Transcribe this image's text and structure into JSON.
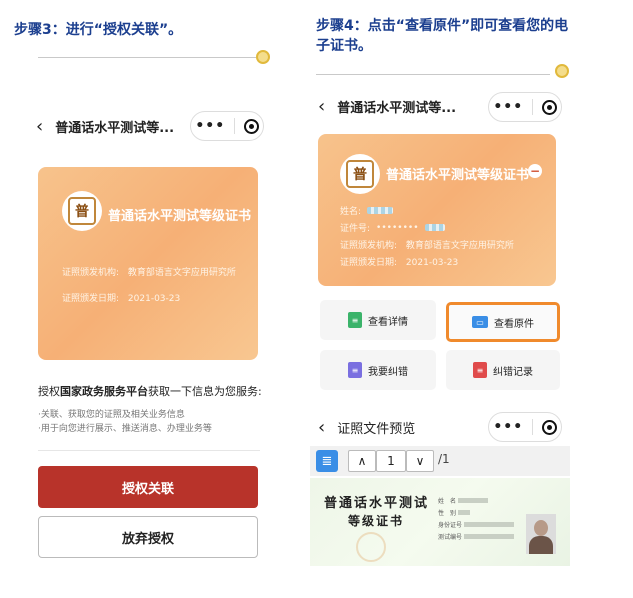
{
  "left": {
    "step_title": "步骤3：进行“授权关联”。",
    "nav_title": "普通话水平测试等...",
    "card": {
      "title": "普通话水平测试等级证书",
      "seal_char": "普",
      "issuer_label": "证照颁发机构:",
      "issuer_value": "教育部语言文字应用研究所",
      "date_label": "证照颁发日期:",
      "date_value": "2021-03-23"
    },
    "auth_text_pre": "授权",
    "auth_text_bold": "国家政务服务平台",
    "auth_text_post": "获取一下信息为您服务:",
    "bullets": [
      "·关联、获取您的证照及相关业务信息",
      "·用于向您进行展示、推送消息、办理业务等"
    ],
    "authorize_button": "授权关联",
    "decline_button": "放弃授权"
  },
  "right": {
    "step_title_line1": "步骤4：点击“查看原件”即可查看您的电",
    "step_title_line2": "子证书。",
    "nav_title": "普通话水平测试等...",
    "card": {
      "title": "普通话水平测试等级证书",
      "seal_char": "普",
      "name_label": "姓名:",
      "id_label": "证件号:",
      "id_value": "••••••••",
      "issuer_label": "证照颁发机构:",
      "issuer_value": "教育部语言文字应用研究所",
      "date_label": "证照颁发日期:",
      "date_value": "2021-03-23"
    },
    "actions": [
      {
        "label": "查看详情",
        "icon": "document-green-icon"
      },
      {
        "label": "查看原件",
        "icon": "id-card-blue-icon"
      },
      {
        "label": "我要纠错",
        "icon": "document-purple-icon"
      },
      {
        "label": "纠错记录",
        "icon": "document-red-icon"
      }
    ],
    "preview_title": "证照文件预览",
    "toolbar": {
      "up": "∧",
      "page": "1",
      "down": "∨",
      "total": "/1"
    },
    "document": {
      "title_line1": "普通话水平测试",
      "title_line2": "等级证书",
      "field_name": "姓　名",
      "field_gender": "性　别",
      "field_id": "身份证号",
      "field_no": "测试编号"
    }
  },
  "colors": {
    "step_title": "#1c3f8f",
    "primary_button": "#b8332a",
    "highlight_border": "#f08a2c",
    "card_orange": "#f6b076"
  }
}
